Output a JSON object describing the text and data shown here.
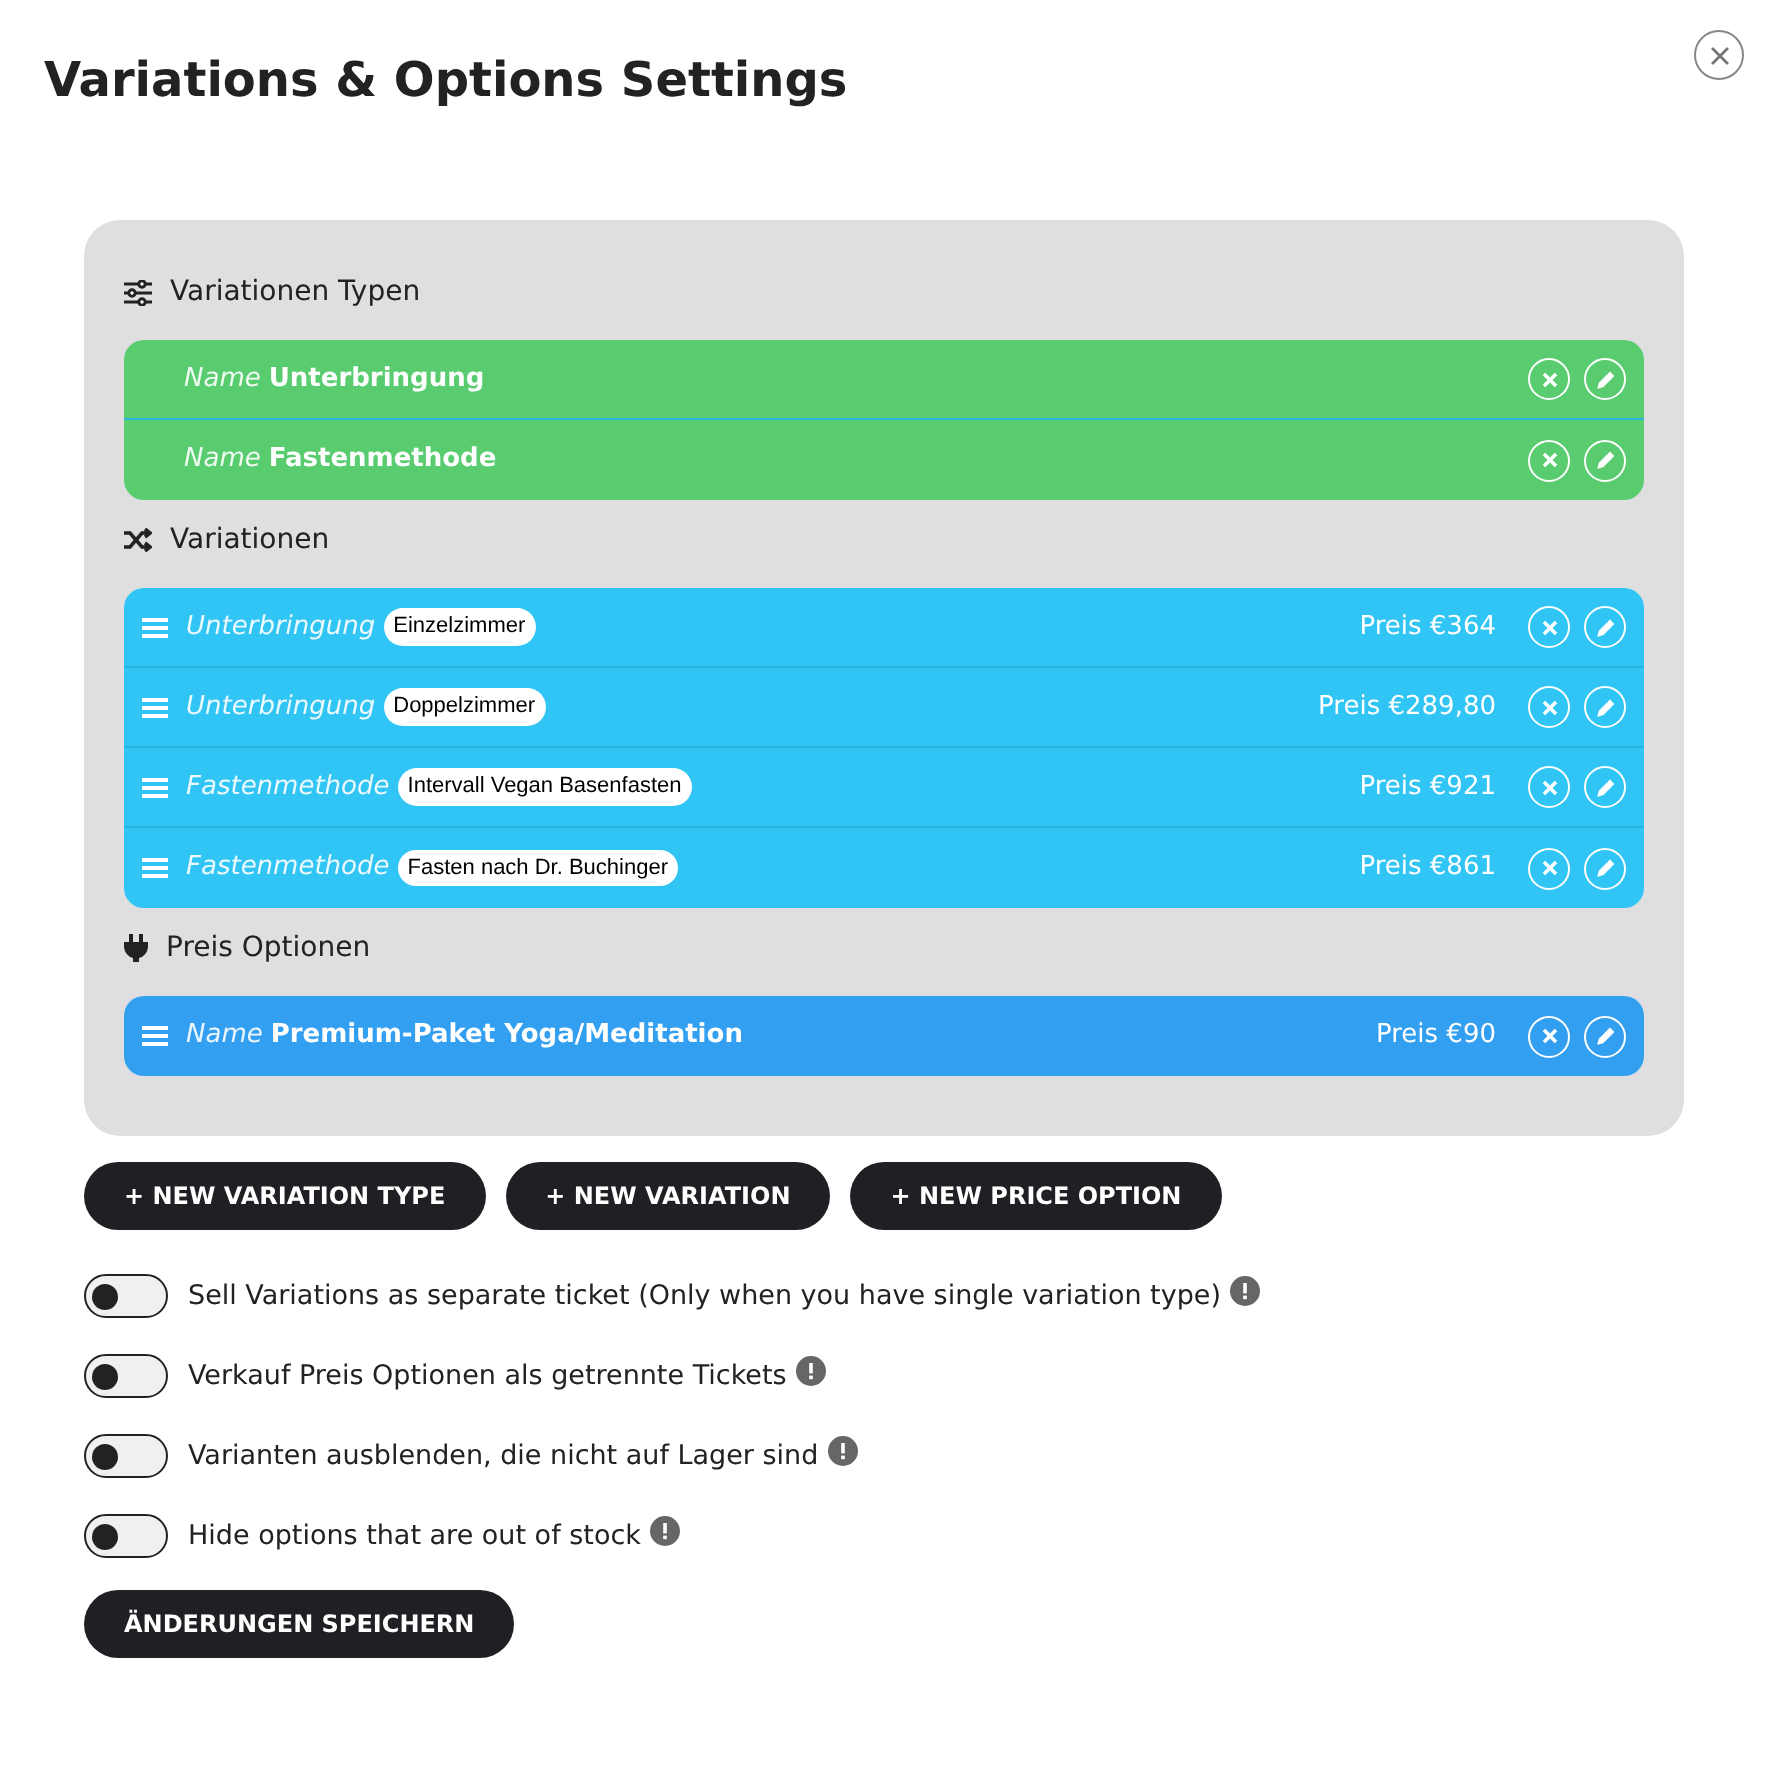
{
  "dialog": {
    "title": "Variations & Options Settings"
  },
  "sections": [
    {
      "kind": "types",
      "heading": "Variationen Typen",
      "rows": [
        {
          "label": "Name",
          "name": "Unterbringung"
        },
        {
          "label": "Name",
          "name": "Fastenmethode"
        }
      ]
    },
    {
      "kind": "variations",
      "heading": "Variationen",
      "rows": [
        {
          "label": "Unterbringung",
          "tag": "Einzelzimmer",
          "price": "Preis €364"
        },
        {
          "label": "Unterbringung",
          "tag": "Doppelzimmer",
          "price": "Preis €289,80"
        },
        {
          "label": "Fastenmethode",
          "tag": "Intervall Vegan Basenfasten",
          "price": "Preis €921"
        },
        {
          "label": "Fastenmethode",
          "tag": "Fasten nach Dr. Buchinger",
          "price": "Preis €861"
        }
      ]
    },
    {
      "kind": "price_options",
      "heading": "Preis Optionen",
      "rows": [
        {
          "label": "Name",
          "name": "Premium-Paket Yoga/Meditation",
          "price": "Preis €90"
        }
      ]
    }
  ],
  "buttons": [
    "+ NEW VARIATION TYPE",
    "+ NEW VARIATION",
    "+ NEW PRICE OPTION"
  ],
  "toggles": [
    {
      "label": "Sell Variations as separate ticket (Only when you have single variation type)",
      "on": false
    },
    {
      "label": "Verkauf Preis Optionen als getrennte Tickets",
      "on": false
    },
    {
      "label": "Varianten ausblenden, die nicht auf Lager sind",
      "on": false
    },
    {
      "label": "Hide options that are out of stock",
      "on": false
    }
  ],
  "save_button": "ÄNDERUNGEN SPEICHERN"
}
